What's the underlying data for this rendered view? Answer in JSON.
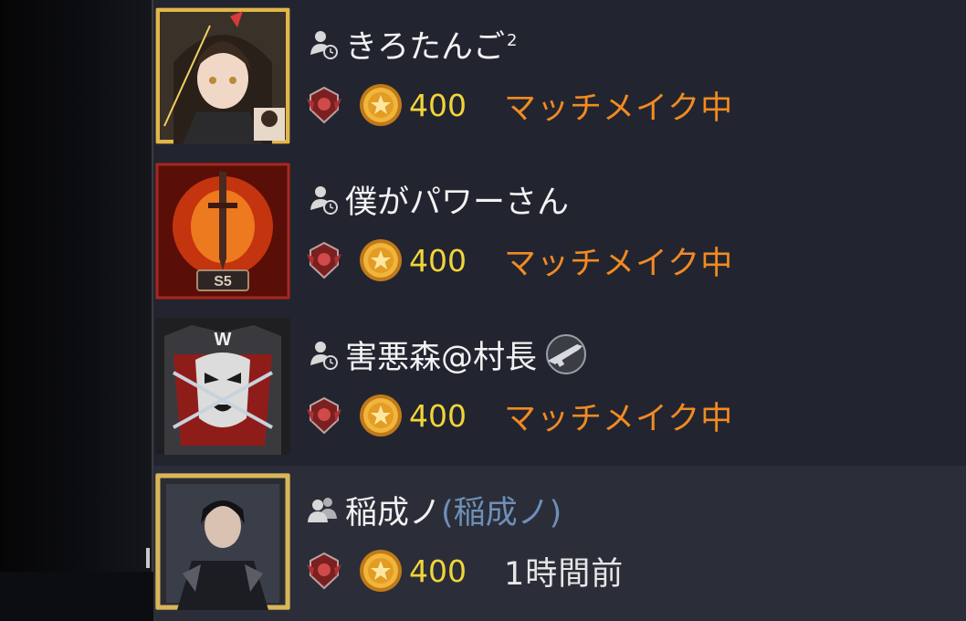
{
  "friends": [
    {
      "name": "きろたんご",
      "name_sup": "2",
      "alias": "",
      "coins": "400",
      "status": "マッチメイク中",
      "status_type": "active",
      "presence_icon": "single-user-clock-icon",
      "avatar": "anime-girl-avatar",
      "extra_badge": ""
    },
    {
      "name": "僕がパワーさん",
      "name_sup": "",
      "alias": "",
      "coins": "400",
      "status": "マッチメイク中",
      "status_type": "active",
      "presence_icon": "single-user-clock-icon",
      "avatar": "flaming-sword-avatar",
      "avatar_text": "S5",
      "extra_badge": ""
    },
    {
      "name": "害悪森@村長",
      "name_sup": "",
      "alias": "",
      "coins": "400",
      "status": "マッチメイク中",
      "status_type": "active",
      "presence_icon": "single-user-clock-icon",
      "avatar": "masked-warrior-avatar",
      "avatar_text": "W",
      "extra_badge": "weapon-badge-icon"
    },
    {
      "name": "稲成ノ",
      "name_sup": "",
      "alias": "(稲成ノ)",
      "coins": "400",
      "status": "1時間前",
      "status_type": "idle",
      "presence_icon": "two-users-icon",
      "avatar": "dark-woman-avatar",
      "extra_badge": ""
    }
  ],
  "colors": {
    "panel": "#222530",
    "row_alt": "#2b2e38",
    "status_active": "#f28a22",
    "coins": "#f2d43a",
    "alias": "#6f8fb8"
  }
}
